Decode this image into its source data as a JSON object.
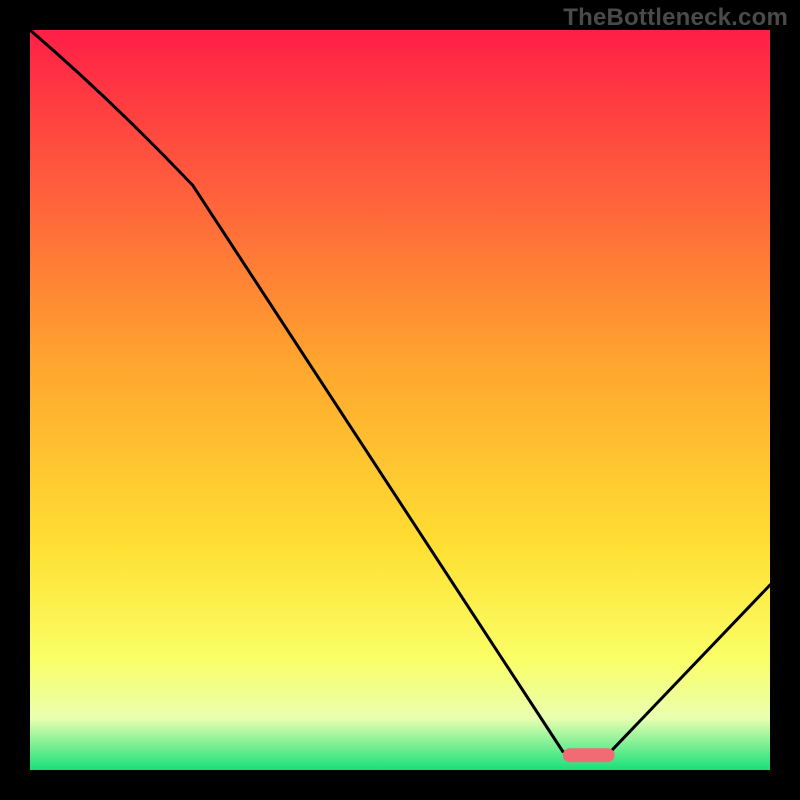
{
  "watermark": "TheBottleneck.com",
  "chart_data": {
    "type": "line",
    "title": "",
    "xlabel": "",
    "ylabel": "",
    "xlim": [
      0,
      100
    ],
    "ylim": [
      0,
      100
    ],
    "series": [
      {
        "name": "bottleneck-curve",
        "x": [
          0,
          22,
          72,
          78,
          100
        ],
        "y": [
          100,
          79,
          2.5,
          2,
          25
        ],
        "color": "#000000"
      }
    ],
    "marker": {
      "name": "optimal-range",
      "x_range": [
        72,
        79
      ],
      "y": 2,
      "color": "#f16b75"
    },
    "background_gradient": {
      "stops": [
        {
          "offset": 0.0,
          "color": "#ff1f46"
        },
        {
          "offset": 0.2,
          "color": "#ff5a3d"
        },
        {
          "offset": 0.45,
          "color": "#ffa52e"
        },
        {
          "offset": 0.7,
          "color": "#ffe033"
        },
        {
          "offset": 0.85,
          "color": "#faff66"
        },
        {
          "offset": 0.93,
          "color": "#e9ffb0"
        },
        {
          "offset": 1.0,
          "color": "#18e07a"
        }
      ]
    }
  }
}
